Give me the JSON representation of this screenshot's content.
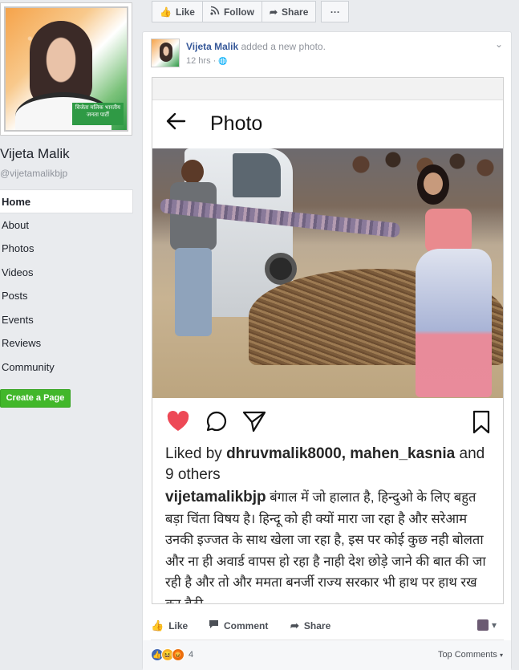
{
  "page": {
    "name": "Vijeta Malik",
    "handle": "@vijetamalikbjp",
    "profile_badge_text": "विजेता मलिक भारतीय जनता पार्टी"
  },
  "nav": {
    "items": [
      "Home",
      "About",
      "Photos",
      "Videos",
      "Posts",
      "Events",
      "Reviews",
      "Community"
    ],
    "active": "Home",
    "create_page_label": "Create a Page"
  },
  "topbar": {
    "like_label": "Like",
    "follow_label": "Follow",
    "share_label": "Share",
    "more_label": "···"
  },
  "post": {
    "author": "Vijeta Malik",
    "action_text": "added a new photo.",
    "time": "12 hrs",
    "audience_glyph": "🌐",
    "instagram": {
      "title": "Photo",
      "liked_by_prefix": "Liked by",
      "liked_by_users": "dhruvmalik8000, mahen_kasnia",
      "liked_by_suffix": "and 9 others",
      "caption_user": "vijetamalikbjp",
      "caption_text": "बंगाल में जो हालात है, हिन्दुओ के लिए बहुत बड़ा चिंता विषय है। हिन्दू को ही क्यों मारा जा रहा है और सरेआम उनकी इज्जत के साथ खेला जा रहा है, इस पर कोई कुछ नही बोलता और ना ही अवार्ड वापस हो रहा है नाही देश छोड़े जाने की बात की जा रही है और तो और ममता बनर्जी राज्य सरकार भी हाथ पर हाथ रख कर बैठी"
    },
    "actions": {
      "like": "Like",
      "comment": "Comment",
      "share": "Share"
    },
    "reactions_count": "4",
    "top_comments_label": "Top Comments"
  },
  "colors": {
    "fb_blue": "#365899",
    "green_button": "#42b72a",
    "heart_red": "#ed4956"
  }
}
